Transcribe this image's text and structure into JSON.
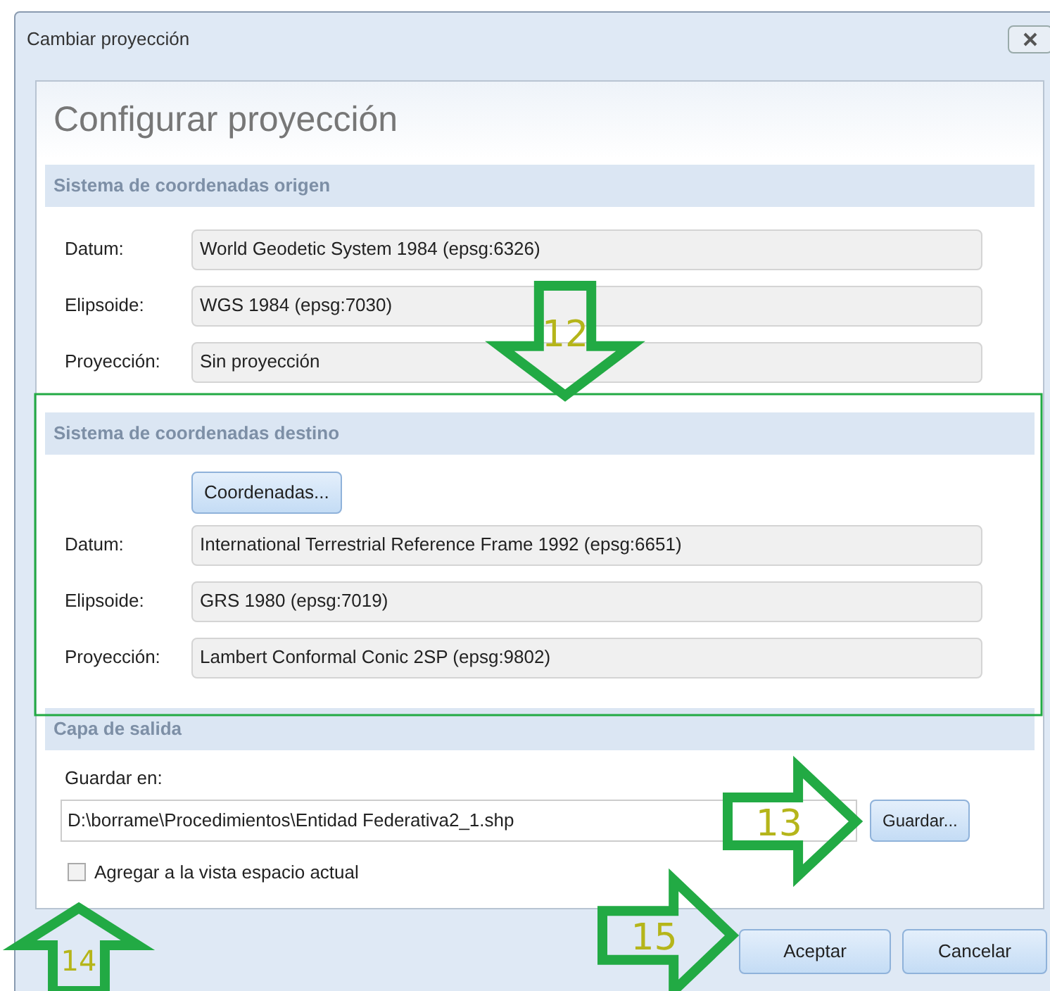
{
  "window": {
    "title": "Cambiar proyección"
  },
  "heading": "Configurar proyección",
  "source": {
    "title": "Sistema de coordenadas origen",
    "fields": [
      {
        "label": "Datum:",
        "value": "World Geodetic System 1984 (epsg:6326)"
      },
      {
        "label": "Elipsoide:",
        "value": "WGS 1984 (epsg:7030)"
      },
      {
        "label": "Proyección:",
        "value": "Sin proyección"
      }
    ]
  },
  "target": {
    "title": "Sistema de coordenadas destino",
    "button": {
      "label": "Coordenadas..."
    },
    "fields": [
      {
        "label": "Datum:",
        "value": "International Terrestrial Reference Frame 1992 (epsg:6651)"
      },
      {
        "label": "Elipsoide:",
        "value": "GRS 1980 (epsg:7019)"
      },
      {
        "label": "Proyección:",
        "value": "Lambert Conformal Conic 2SP (epsg:9802)"
      }
    ]
  },
  "output": {
    "title": "Capa de salida",
    "save_label": {
      "text": "Guardar en:"
    },
    "path": "D:\\borrame\\Procedimientos\\Entidad Federativa2_1.shp",
    "browse": {
      "label": "Guardar..."
    },
    "add_to_view": {
      "label": "Agregar a la vista espacio actual",
      "checked": false
    }
  },
  "buttons": [
    {
      "label": "Aceptar"
    },
    {
      "label": "Cancelar"
    }
  ],
  "annotations": [
    {
      "kind": "arrow_down",
      "label": "12"
    },
    {
      "kind": "arrow_right",
      "label": "13"
    },
    {
      "kind": "arrow_up",
      "label": "14"
    },
    {
      "kind": "arrow_right",
      "label": "15"
    },
    {
      "kind": "frame"
    }
  ]
}
